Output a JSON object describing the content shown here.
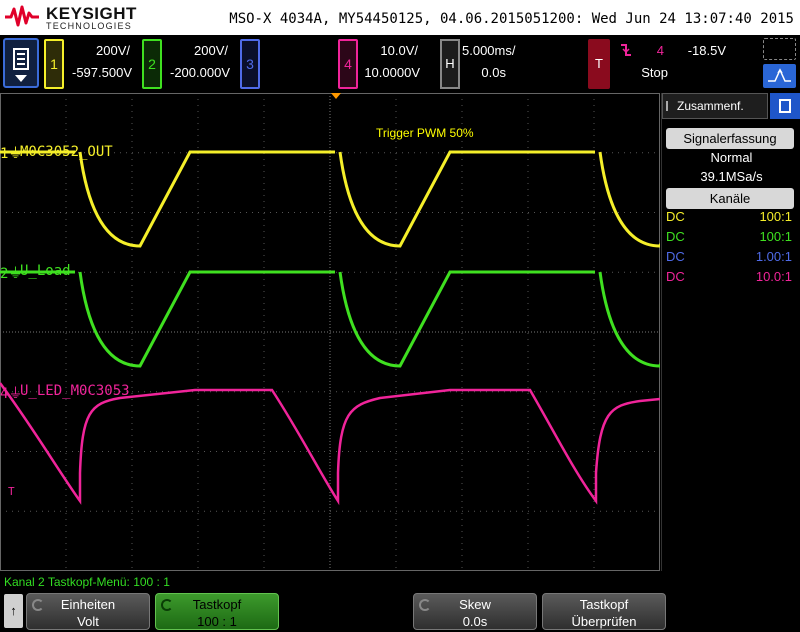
{
  "brand": {
    "name": "KEYSIGHT",
    "sub": "TECHNOLOGIES"
  },
  "title": "MSO-X 4034A, MY54450125, 04.06.2015051200: Wed Jun 24 13:07:40 2015",
  "colors": {
    "ch1": "#f5ef2a",
    "ch2": "#3fe020",
    "ch3": "#4f6be8",
    "ch4": "#f0249a",
    "accent": "#2a66d6",
    "grid": "#555555"
  },
  "channels": [
    {
      "num": "1",
      "scale": "200V/",
      "offset": "-597.500V"
    },
    {
      "num": "2",
      "scale": "200V/",
      "offset": "-200.000V"
    },
    {
      "num": "3",
      "scale": "",
      "offset": ""
    },
    {
      "num": "4",
      "scale": "10.0V/",
      "offset": "10.0000V"
    }
  ],
  "horizontal": {
    "label": "H",
    "timebase": "5.000ms/",
    "delay": "0.0s"
  },
  "trigger": {
    "label": "T",
    "slope_icon": "falling-edge-icon",
    "source": "4",
    "level": "-18.5V",
    "mode": "Stop"
  },
  "waveform_labels": {
    "ch1": "M0C3052_OUT",
    "ch2": "U_Load",
    "ch4": "U_LED_M0C3053"
  },
  "waveform_markers": {
    "ch1": "1",
    "ch2": "2",
    "ch4": "4",
    "trigger": "T"
  },
  "annotation": "Trigger PWM 50%",
  "side_panel": {
    "tab_label": "Zusammenf.",
    "acq_button": "Signalerfassung",
    "acq_mode": "Normal",
    "sample_rate": "39.1MSa/s",
    "channels_button": "Kanäle",
    "channel_rows": [
      {
        "coupling": "DC",
        "probe": "100:1"
      },
      {
        "coupling": "DC",
        "probe": "100:1"
      },
      {
        "coupling": "DC",
        "probe": "1.00:1"
      },
      {
        "coupling": "DC",
        "probe": "10.0:1"
      }
    ]
  },
  "status_line": "Kanal 2 Tastkopf-Menü: 100 : 1",
  "softkeys": [
    {
      "title": "Einheiten",
      "value": "Volt"
    },
    {
      "title": "Tastkopf",
      "value": "100 : 1"
    },
    {
      "title": "",
      "value": ""
    },
    {
      "title": "Skew",
      "value": "0.0s"
    },
    {
      "title": "Tastkopf",
      "value": "Überprüfen"
    }
  ],
  "up_arrow": "↑"
}
